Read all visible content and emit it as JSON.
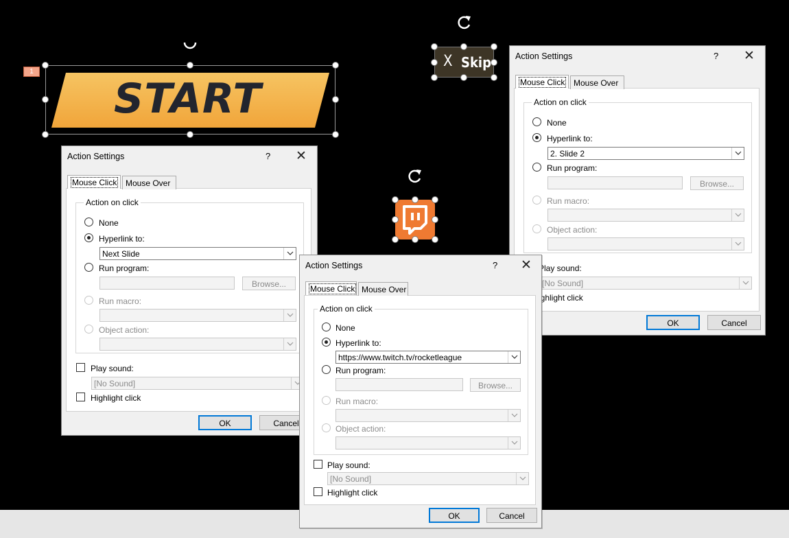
{
  "slide": {
    "slide_number": "1",
    "start_button_text": "START",
    "skip_button": {
      "x_glyph": "X",
      "label": "Skip"
    }
  },
  "colors": {
    "start_gold": "#f4b24a",
    "start_text": "#22252e",
    "skip_bg": "#3d3526",
    "twitch_bg": "#ef7a32",
    "default_button_border": "#0078d7"
  },
  "dialogs": [
    {
      "title": "Action Settings",
      "help": "?",
      "tabs": [
        "Mouse Click",
        "Mouse Over"
      ],
      "group_label": "Action on click",
      "options": {
        "none": "None",
        "hyperlink": "Hyperlink to:",
        "run_program": "Run program:",
        "run_macro": "Run macro:",
        "object_action": "Object action:"
      },
      "hyperlink_value": "Next Slide",
      "browse": "Browse...",
      "play_sound": "Play sound:",
      "sound_value": "[No Sound]",
      "highlight": "Highlight click",
      "ok": "OK",
      "cancel": "Cancel"
    },
    {
      "title": "Action Settings",
      "help": "?",
      "tabs": [
        "Mouse Click",
        "Mouse Over"
      ],
      "group_label": "Action on click",
      "options": {
        "none": "None",
        "hyperlink": "Hyperlink to:",
        "run_program": "Run program:",
        "run_macro": "Run macro:",
        "object_action": "Object action:"
      },
      "hyperlink_value": "2. Slide 2",
      "browse": "Browse...",
      "play_sound": "Play sound:",
      "sound_value": "[No Sound]",
      "highlight": "ighlight click",
      "ok": "OK",
      "cancel": "Cancel"
    },
    {
      "title": "Action Settings",
      "help": "?",
      "tabs": [
        "Mouse Click",
        "Mouse Over"
      ],
      "group_label": "Action on click",
      "options": {
        "none": "None",
        "hyperlink": "Hyperlink to:",
        "run_program": "Run program:",
        "run_macro": "Run macro:",
        "object_action": "Object action:"
      },
      "hyperlink_value": "https://www.twitch.tv/rocketleague",
      "browse": "Browse...",
      "play_sound": "Play sound:",
      "sound_value": "[No Sound]",
      "highlight": "Highlight click",
      "ok": "OK",
      "cancel": "Cancel"
    }
  ]
}
